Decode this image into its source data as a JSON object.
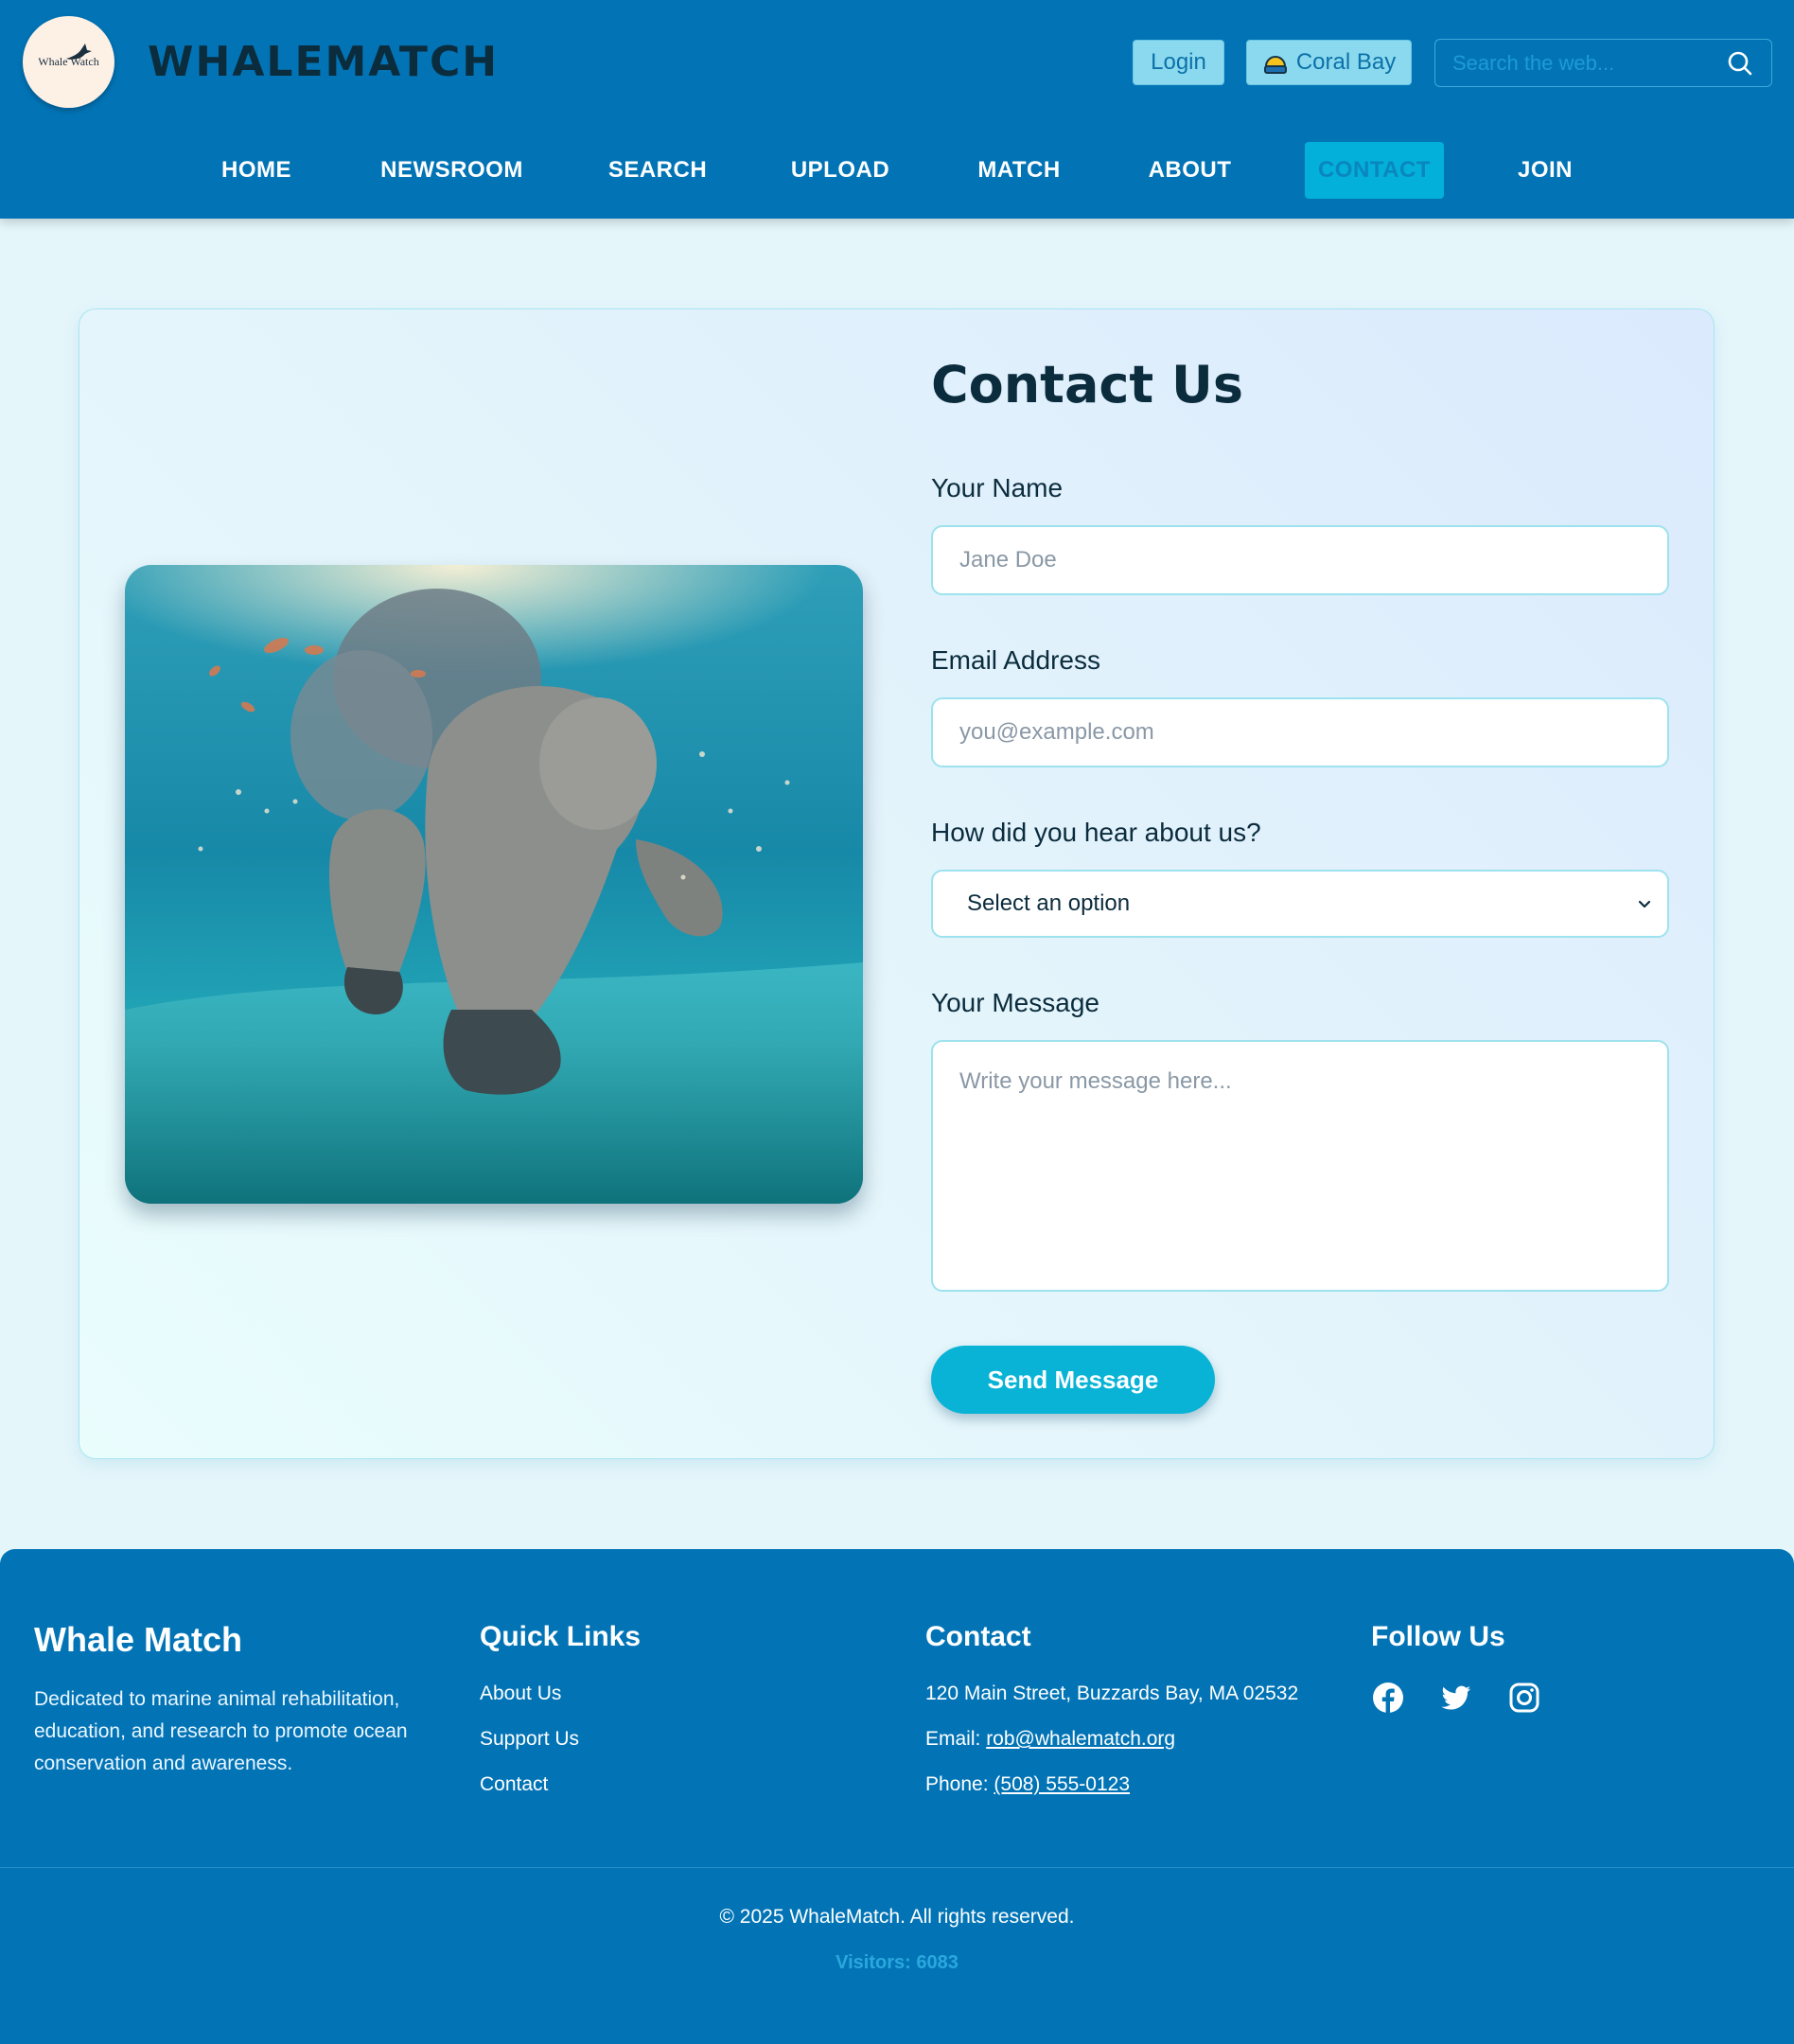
{
  "header": {
    "logo_text": "Whale Watch",
    "brand": "WHALEMATCH",
    "login_label": "Login",
    "location_label": "Coral Bay",
    "search_placeholder": "Search the web..."
  },
  "nav": {
    "items": [
      {
        "label": "HOME"
      },
      {
        "label": "NEWSROOM"
      },
      {
        "label": "SEARCH"
      },
      {
        "label": "UPLOAD"
      },
      {
        "label": "MATCH"
      },
      {
        "label": "ABOUT"
      },
      {
        "label": "CONTACT",
        "active": true
      },
      {
        "label": "JOIN"
      }
    ]
  },
  "contact_form": {
    "title": "Contact Us",
    "name_label": "Your Name",
    "name_placeholder": "Jane Doe",
    "email_label": "Email Address",
    "email_placeholder": "you@example.com",
    "source_label": "How did you hear about us?",
    "source_selected": "Select an option",
    "message_label": "Your Message",
    "message_placeholder": "Write your message here...",
    "submit_label": "Send Message"
  },
  "footer": {
    "about_title": "Whale Match",
    "about_text": "Dedicated to marine animal rehabilitation, education, and research to promote ocean conservation and awareness.",
    "quick_links_title": "Quick Links",
    "quick_links": [
      "About Us",
      "Support Us",
      "Contact"
    ],
    "contact_title": "Contact",
    "address": "120 Main Street, Buzzards Bay, MA 02532",
    "email_prefix": "Email: ",
    "email": "rob@whalematch.org",
    "phone_prefix": "Phone: ",
    "phone": "(508) 555-0123",
    "follow_title": "Follow Us",
    "social_icons": [
      "facebook-icon",
      "twitter-icon",
      "instagram-icon"
    ],
    "copyright": "© 2025 WhaleMatch. All rights reserved.",
    "visitors": "Visitors: 6083"
  },
  "colors": {
    "header_bg": "#0274b6",
    "page_bg": "#e4f6fa",
    "accent": "#08b3d6",
    "brand_text": "#0b2c3d"
  }
}
